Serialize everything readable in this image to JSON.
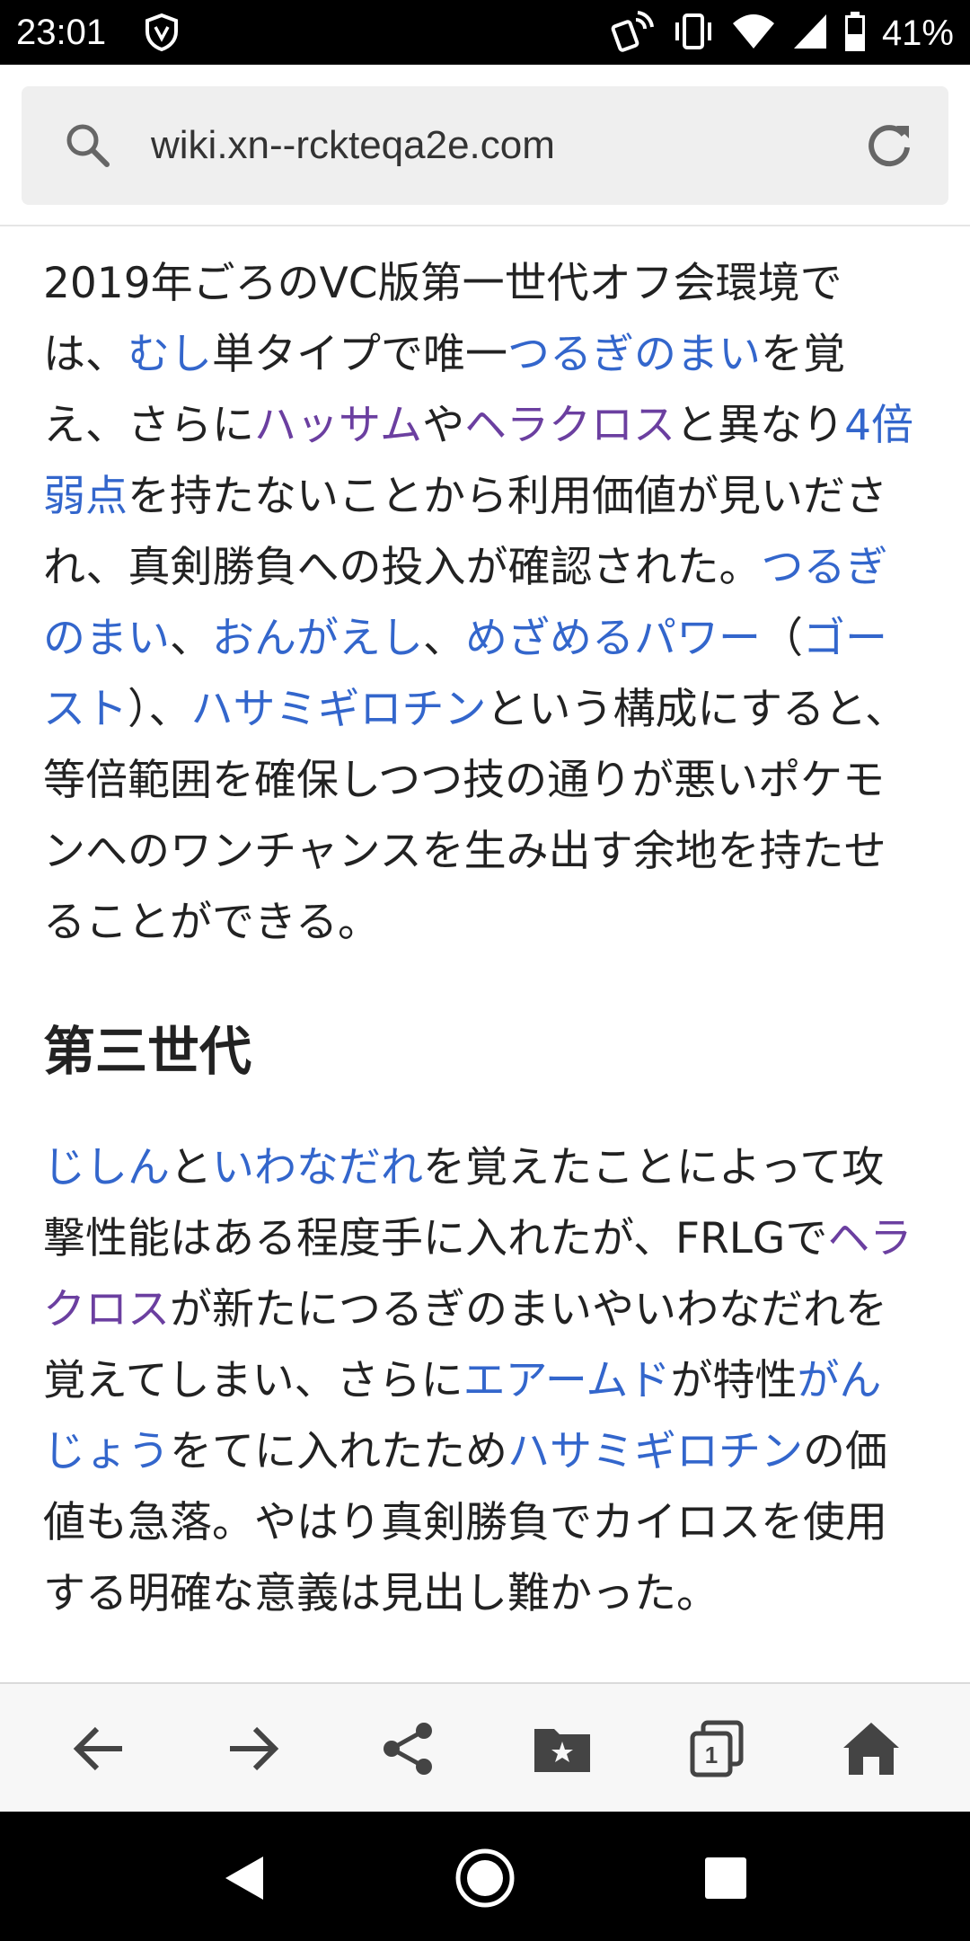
{
  "status_bar": {
    "time": "23:01",
    "battery": "41%",
    "icons": [
      "shield-icon",
      "nfc-icon",
      "vibrate-icon",
      "wifi-icon",
      "signal-icon",
      "battery-icon"
    ]
  },
  "url_bar": {
    "url": "wiki.xn--rckteqa2e.com",
    "search_icon": "search-icon",
    "reload_icon": "reload-icon"
  },
  "colors": {
    "link": "#3366cc",
    "visited_link": "#6b3fa0",
    "text": "#222222"
  },
  "article": {
    "para1": [
      {
        "t": "2019年ごろのVC版第一世代オフ会環境では、"
      },
      {
        "t": "むし",
        "link": "link"
      },
      {
        "t": "単タイプで唯一"
      },
      {
        "t": "つるぎのまい",
        "link": "link"
      },
      {
        "t": "を覚え、さらに"
      },
      {
        "t": "ハッサム",
        "link": "visited"
      },
      {
        "t": "や"
      },
      {
        "t": "ヘラクロス",
        "link": "visited"
      },
      {
        "t": "と異なり"
      },
      {
        "t": "4倍弱点",
        "link": "link"
      },
      {
        "t": "を持たないことから利用価値が見いだされ、真剣勝負への投入が確認された。"
      },
      {
        "t": "つるぎのまい",
        "link": "link"
      },
      {
        "t": "、"
      },
      {
        "t": "おんがえし",
        "link": "link"
      },
      {
        "t": "、"
      },
      {
        "t": "めざめるパワー",
        "link": "link"
      },
      {
        "t": "（"
      },
      {
        "t": "ゴースト",
        "link": "link"
      },
      {
        "t": "）、"
      },
      {
        "t": "ハサミギロチン",
        "link": "link"
      },
      {
        "t": "という構成にすると、等倍範囲を確保しつつ技の通りが悪いポケモンへのワンチャンスを生み出す余地を持たせることができる。"
      }
    ],
    "heading": "第三世代",
    "para2": [
      {
        "t": "じしん",
        "link": "link"
      },
      {
        "t": "と"
      },
      {
        "t": "いわなだれ",
        "link": "link"
      },
      {
        "t": "を覚えたことによって攻撃性能はある程度手に入れたが、FRLGで"
      },
      {
        "t": "ヘラクロス",
        "link": "visited"
      },
      {
        "t": "が新たにつるぎのまいやいわなだれを覚えてしまい、さらに"
      },
      {
        "t": "エアームド",
        "link": "link"
      },
      {
        "t": "が特性"
      },
      {
        "t": "がんじょう",
        "link": "link"
      },
      {
        "t": "をてに入れたため"
      },
      {
        "t": "ハサミギロチン",
        "link": "link"
      },
      {
        "t": "の価値も急落。やはり真剣勝負でカイロスを使用する明確な意義は見出し難かった。"
      }
    ]
  },
  "toolbar": {
    "buttons": [
      "back-arrow-icon",
      "forward-arrow-icon",
      "share-icon",
      "bookmark-folder-icon",
      "tabs-icon",
      "home-icon"
    ],
    "tab_count": "1"
  },
  "nav_bar": {
    "buttons": [
      "back-triangle-icon",
      "home-circle-icon",
      "recents-square-icon"
    ]
  }
}
